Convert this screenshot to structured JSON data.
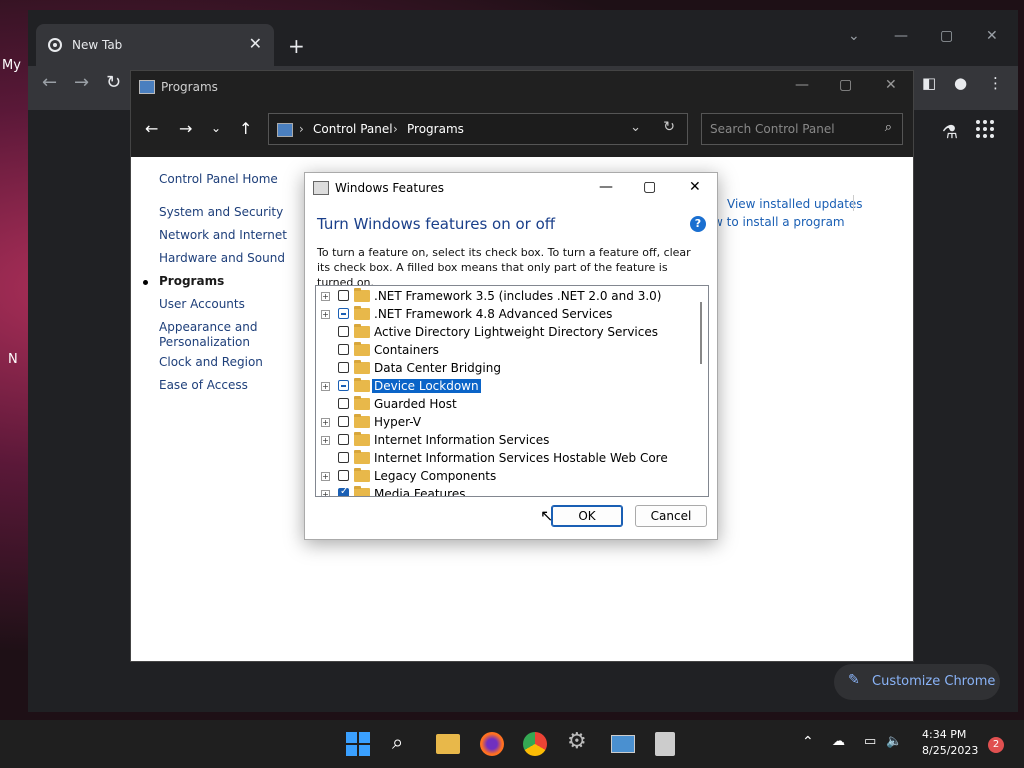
{
  "desktop": {
    "text1": "My",
    "text2": "N"
  },
  "chrome": {
    "tab_title": "New Tab",
    "tab_close": "✕",
    "new_tab": "+",
    "customize_label": "Customize Chrome"
  },
  "control_panel": {
    "title": "Programs",
    "breadcrumb": [
      "Control Panel",
      "Programs"
    ],
    "search_placeholder": "Search Control Panel",
    "left_links": [
      "Control Panel Home",
      "System and Security",
      "Network and Internet",
      "Hardware and Sound",
      "Programs",
      "User Accounts",
      "Appearance and",
      "Personalization",
      "Clock and Region",
      "Ease of Access"
    ],
    "right_links": [
      "View installed updates",
      "w to install a program"
    ]
  },
  "dialog": {
    "title": "Windows Features",
    "heading": "Turn Windows features on or off",
    "help": "?",
    "description": "To turn a feature on, select its check box. To turn a feature off, clear its check box. A filled box means that only part of the feature is turned on.",
    "features": [
      {
        "label": ".NET Framework 3.5 (includes .NET 2.0 and 3.0)",
        "expandable": true,
        "state": "unchecked"
      },
      {
        "label": ".NET Framework 4.8 Advanced Services",
        "expandable": true,
        "state": "partial"
      },
      {
        "label": "Active Directory Lightweight Directory Services",
        "expandable": false,
        "state": "unchecked"
      },
      {
        "label": "Containers",
        "expandable": false,
        "state": "unchecked"
      },
      {
        "label": "Data Center Bridging",
        "expandable": false,
        "state": "unchecked"
      },
      {
        "label": "Device Lockdown",
        "expandable": true,
        "state": "partial",
        "selected": true
      },
      {
        "label": "Guarded Host",
        "expandable": false,
        "state": "unchecked"
      },
      {
        "label": "Hyper-V",
        "expandable": true,
        "state": "unchecked"
      },
      {
        "label": "Internet Information Services",
        "expandable": true,
        "state": "unchecked"
      },
      {
        "label": "Internet Information Services Hostable Web Core",
        "expandable": false,
        "state": "unchecked"
      },
      {
        "label": "Legacy Components",
        "expandable": true,
        "state": "unchecked"
      },
      {
        "label": "Media Features",
        "expandable": true,
        "state": "checked"
      }
    ],
    "ok_label": "OK",
    "cancel_label": "Cancel"
  },
  "taskbar": {
    "time": "4:34 PM",
    "date": "8/25/2023",
    "notification_count": "2"
  },
  "colors": {
    "accent": "#1a5fb4",
    "selection": "#0a64c8",
    "heading": "#1a3f8a"
  }
}
